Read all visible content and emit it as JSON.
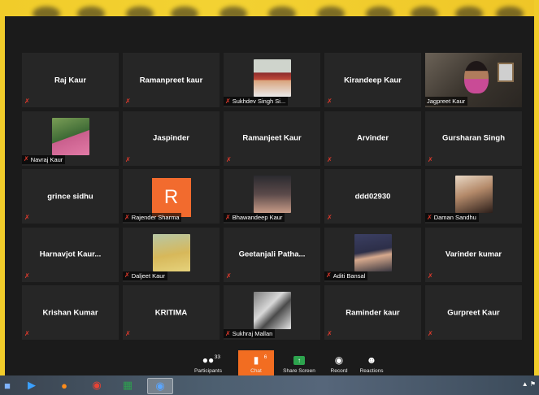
{
  "participants": [
    {
      "name": "Raj Kaur",
      "type": "name"
    },
    {
      "name": "Ramanpreet kaur",
      "type": "name"
    },
    {
      "name": "Sukhdev Singh Si...",
      "type": "photo",
      "photo": "p1"
    },
    {
      "name": "Kirandeep Kaur",
      "type": "name"
    },
    {
      "name": "Jagpreet Kaur",
      "type": "camera",
      "active": true
    },
    {
      "name": "Navraj Kaur",
      "type": "photo",
      "photo": "p2"
    },
    {
      "name": "Jaspinder",
      "type": "name"
    },
    {
      "name": "Ramanjeet Kaur",
      "type": "name"
    },
    {
      "name": "Arvinder",
      "type": "name"
    },
    {
      "name": "Gursharan Singh",
      "type": "name"
    },
    {
      "name": "grince sidhu",
      "type": "name"
    },
    {
      "name": "Rajender Sharma",
      "type": "initial",
      "initial": "R"
    },
    {
      "name": "Bhawandeep Kaur",
      "type": "photo",
      "photo": "p3"
    },
    {
      "name": "ddd02930",
      "type": "name"
    },
    {
      "name": "Daman Sandhu",
      "type": "photo",
      "photo": "p4"
    },
    {
      "name": "Harnavjot  Kaur...",
      "type": "name"
    },
    {
      "name": "Daljeet Kaur",
      "type": "photo",
      "photo": "p5"
    },
    {
      "name": "Geetanjali  Patha...",
      "type": "name"
    },
    {
      "name": "Aditi Bansal",
      "type": "photo",
      "photo": "p6"
    },
    {
      "name": "Varinder kumar",
      "type": "name"
    },
    {
      "name": "Krishan Kumar",
      "type": "name"
    },
    {
      "name": "KRITIMA",
      "type": "name"
    },
    {
      "name": "Sukhraj Mallan",
      "type": "photo",
      "photo": "p7"
    },
    {
      "name": "Raminder kaur",
      "type": "name"
    },
    {
      "name": "Gurpreet Kaur",
      "type": "name"
    }
  ],
  "toolbar": {
    "participants_label": "Participants",
    "participants_count": "33",
    "chat_label": "Chat",
    "chat_count": "6",
    "share_label": "Share Screen",
    "record_label": "Record",
    "reactions_label": "Reactions"
  },
  "colors": {
    "accent": "#f26d21",
    "frame": "#f1cc2a",
    "active_border": "#b4d33a",
    "muted": "#e23a2c"
  }
}
